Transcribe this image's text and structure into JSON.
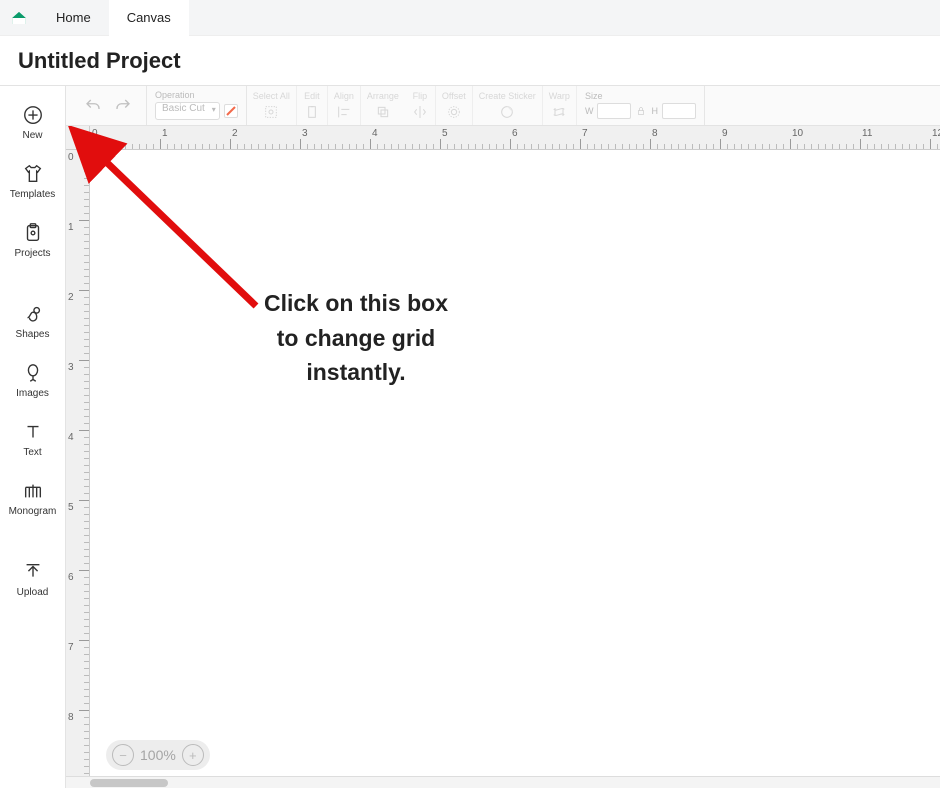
{
  "topbar": {
    "tabs": [
      {
        "label": "Home",
        "active": false
      },
      {
        "label": "Canvas",
        "active": true
      }
    ]
  },
  "project": {
    "title": "Untitled Project"
  },
  "sidebar": {
    "items": [
      {
        "label": "New",
        "icon": "plus-circle"
      },
      {
        "label": "Templates",
        "icon": "tshirt"
      },
      {
        "label": "Projects",
        "icon": "clipboard"
      },
      {
        "label": "Shapes",
        "icon": "shapes"
      },
      {
        "label": "Images",
        "icon": "balloon"
      },
      {
        "label": "Text",
        "icon": "text-t"
      },
      {
        "label": "Monogram",
        "icon": "monogram"
      },
      {
        "label": "Upload",
        "icon": "upload"
      }
    ]
  },
  "toolbar": {
    "operation": {
      "label": "Operation",
      "select_value": "Basic Cut",
      "swatch_color": "#f26a4b"
    },
    "buttons": [
      {
        "label": "Select All",
        "icon": "select-all"
      },
      {
        "label": "Edit",
        "icon": "edit"
      },
      {
        "label": "Align",
        "icon": "align"
      },
      {
        "label": "Arrange",
        "icon": "arrange"
      },
      {
        "label": "Flip",
        "icon": "flip"
      },
      {
        "label": "Offset",
        "icon": "offset"
      },
      {
        "label": "Create Sticker",
        "icon": "sticker"
      },
      {
        "label": "Warp",
        "icon": "warp"
      }
    ],
    "size": {
      "label": "Size",
      "w_label": "W",
      "h_label": "H"
    }
  },
  "ruler": {
    "h_labels": [
      "0",
      "1",
      "2",
      "3",
      "4",
      "5",
      "6",
      "7",
      "8",
      "9",
      "10",
      "11",
      "12"
    ],
    "v_labels": [
      "0",
      "1",
      "2",
      "3",
      "4",
      "5",
      "6",
      "7",
      "8"
    ]
  },
  "zoom": {
    "value": "100%"
  },
  "annotation": {
    "line1": "Click on this box",
    "line2": "to change grid",
    "line3": "instantly.",
    "arrow_color": "#e10d0d"
  }
}
